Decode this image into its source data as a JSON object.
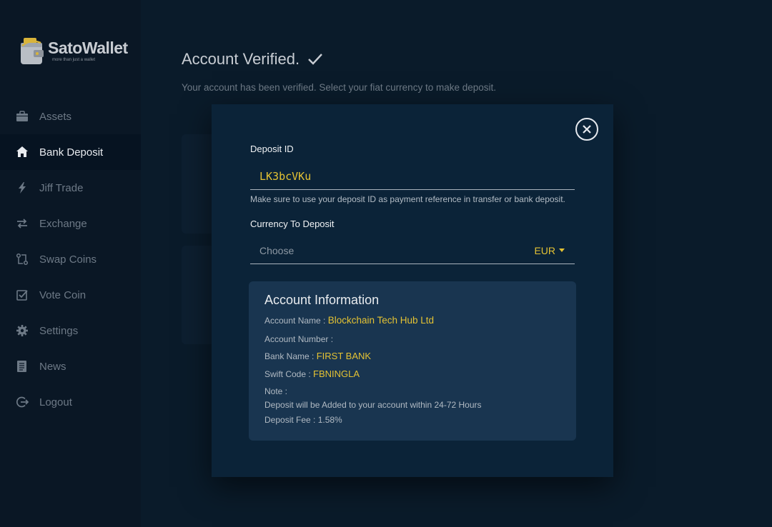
{
  "app": {
    "logo_name": "SatoWallet",
    "logo_tagline": "more than just a wallet"
  },
  "sidebar": {
    "items": [
      {
        "label": "Assets",
        "icon": "briefcase-icon",
        "active": false
      },
      {
        "label": "Bank Deposit",
        "icon": "home-icon",
        "active": true
      },
      {
        "label": "Jiff Trade",
        "icon": "lightning-icon",
        "active": false
      },
      {
        "label": "Exchange",
        "icon": "exchange-arrows-icon",
        "active": false
      },
      {
        "label": "Swap Coins",
        "icon": "swap-icon",
        "active": false
      },
      {
        "label": "Vote Coin",
        "icon": "checkbox-icon",
        "active": false
      },
      {
        "label": "Settings",
        "icon": "gear-icon",
        "active": false
      },
      {
        "label": "News",
        "icon": "document-icon",
        "active": false
      },
      {
        "label": "Logout",
        "icon": "logout-icon",
        "active": false
      }
    ]
  },
  "main": {
    "title": "Account Verified.",
    "subtitle": "Your account has been verified. Select your fiat currency to make deposit."
  },
  "modal": {
    "deposit_id_label": "Deposit ID",
    "deposit_id_value": "LK3bcVKu",
    "helper_text": "Make sure to use your deposit ID as payment reference in transfer or bank deposit.",
    "currency_label": "Currency To Deposit",
    "currency_placeholder": "Choose",
    "currency_value": "EUR",
    "info": {
      "title": "Account Information",
      "account_name_label": "Account Name :",
      "account_name_value": "Blockchain Tech Hub Ltd",
      "account_number_label": "Account Number :",
      "account_number_value": "",
      "bank_name_label": "Bank Name :",
      "bank_name_value": "FIRST BANK",
      "swift_label": "Swift Code :",
      "swift_value": "FBNINGLA",
      "note_label": "Note :",
      "note_text": "Deposit will be Added to your account within 24-72 Hours",
      "fee_text": "Deposit Fee : 1.58%"
    }
  },
  "colors": {
    "accent": "#e4c233",
    "modal_bg": "#0b2338",
    "info_bg": "#193550",
    "sidebar_bg": "#0a1725",
    "page_bg": "#0a1b2a"
  }
}
